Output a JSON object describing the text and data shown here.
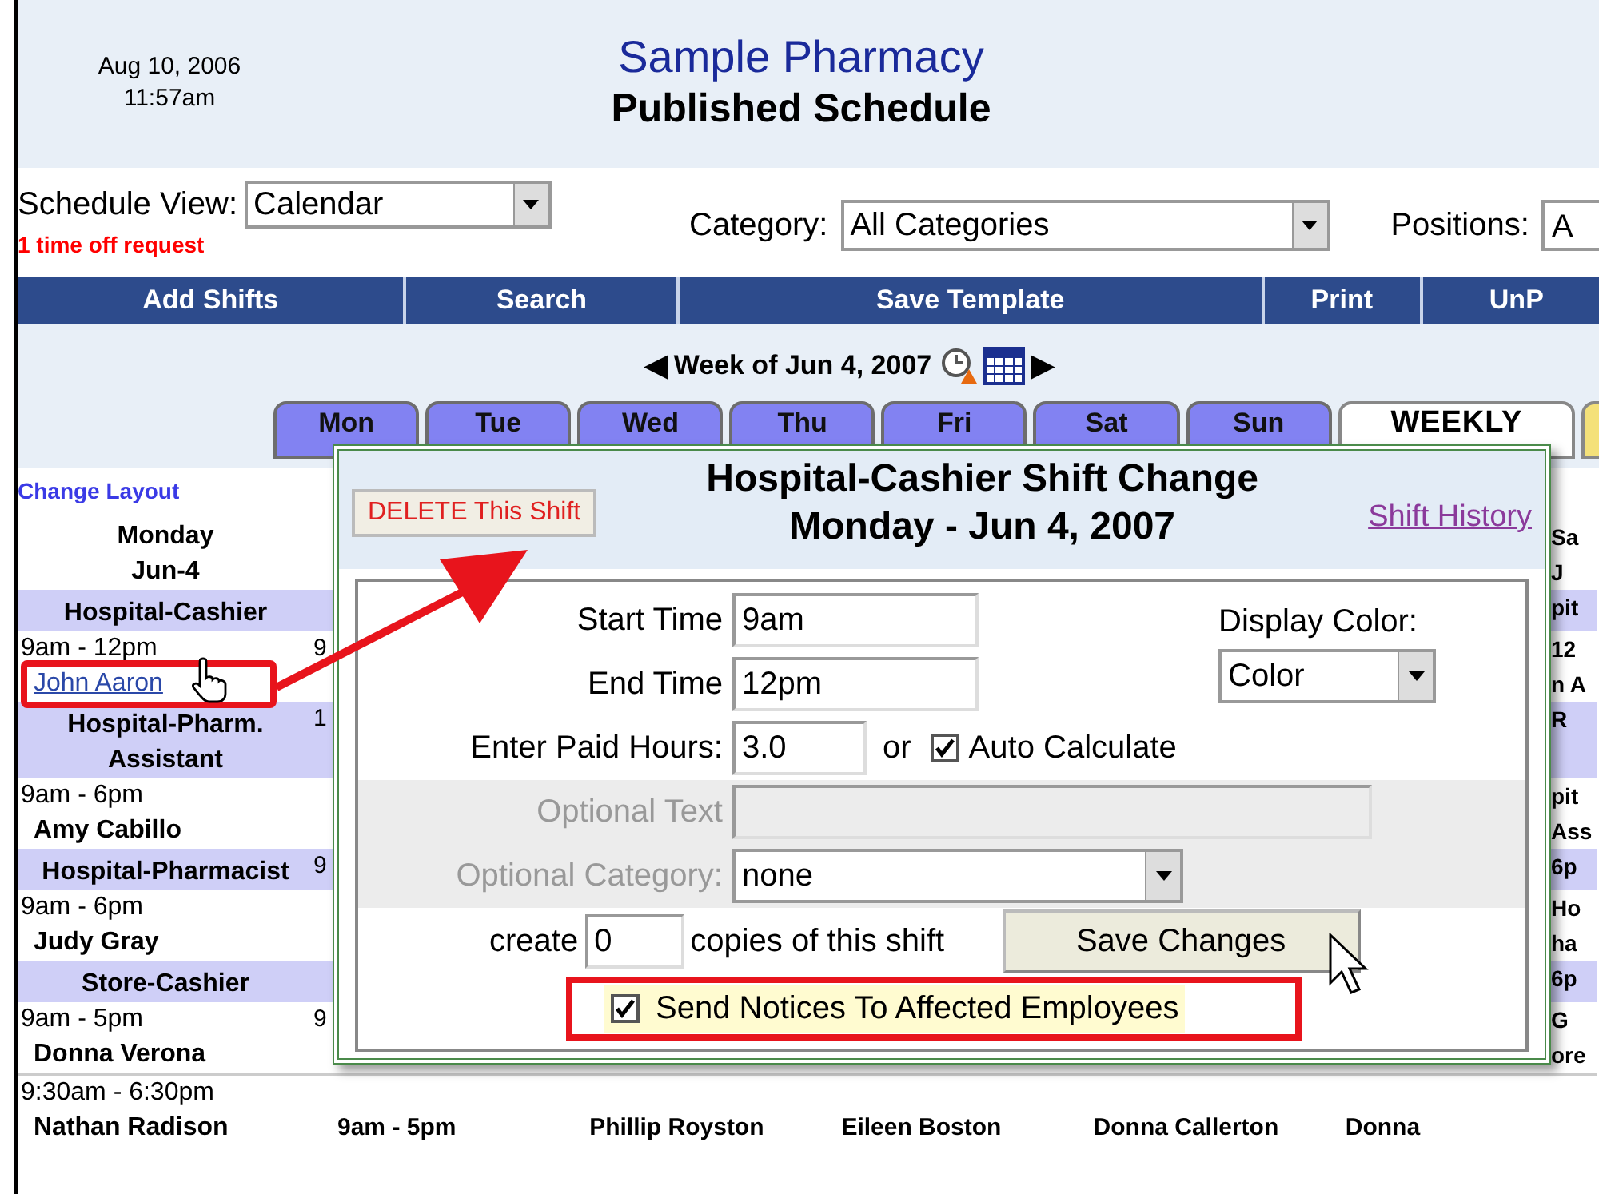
{
  "header": {
    "date": "Aug 10, 2006",
    "time": "11:57am",
    "title": "Sample Pharmacy",
    "subtitle": "Published Schedule"
  },
  "controls": {
    "schedule_view": {
      "label": "Schedule View:",
      "value": "Calendar"
    },
    "notice": "1 time off request",
    "category": {
      "label": "Category:",
      "value": "All Categories"
    },
    "positions": {
      "label": "Positions:",
      "value": "A"
    }
  },
  "nav_bar": [
    "Add Shifts",
    "Search",
    "Save Template",
    "Print",
    "UnP"
  ],
  "week_nav": {
    "prev": "◀",
    "label": "Week of Jun 4, 2007",
    "next": "▶"
  },
  "day_tabs": [
    {
      "label": "Mon",
      "selected": false
    },
    {
      "label": "Tue",
      "selected": false
    },
    {
      "label": "Wed",
      "selected": false
    },
    {
      "label": "Thu",
      "selected": false
    },
    {
      "label": "Fri",
      "selected": false
    },
    {
      "label": "Sat",
      "selected": false
    },
    {
      "label": "Sun",
      "selected": false
    },
    {
      "label": "WEEKLY",
      "selected": true
    }
  ],
  "change_layout": "Change Layout",
  "calendar_rows": [
    {
      "kind": "day",
      "text": "Monday",
      "column_last": "Sa"
    },
    {
      "kind": "day",
      "text": "Jun-4",
      "column_last": "J"
    },
    {
      "kind": "position",
      "text": "Hospital-Cashier",
      "column_last": "pit"
    },
    {
      "kind": "time",
      "text": "9am - 12pm",
      "column_2": "9",
      "column_last": "12"
    },
    {
      "kind": "link",
      "text": "John Aaron",
      "column_last": "n A"
    },
    {
      "kind": "position",
      "text": "Hospital-Pharm. Assistant",
      "column_2": "1",
      "column_last": "R"
    },
    {
      "kind": "time",
      "text": "9am - 6pm",
      "column_last": "pit"
    },
    {
      "kind": "name",
      "text": "Amy Cabillo",
      "column_last": "Ass"
    },
    {
      "kind": "position",
      "text": "Hospital-Pharmacist",
      "column_2": "9",
      "column_last": "6p"
    },
    {
      "kind": "time",
      "text": "9am - 6pm",
      "column_last": "Ho"
    },
    {
      "kind": "name",
      "text": "Judy Gray",
      "column_last": "ha"
    },
    {
      "kind": "position",
      "text": "Store-Cashier",
      "column_last": "6p"
    },
    {
      "kind": "time",
      "text": "9am - 5pm",
      "column_2": "9",
      "column_last": "G"
    },
    {
      "kind": "name",
      "text": "Donna Verona",
      "column_last": "ore"
    },
    {
      "kind": "time",
      "text": "9:30am - 6:30pm"
    },
    {
      "kind": "name",
      "text": "Nathan Radison",
      "middle": [
        "9am - 5pm",
        "Phillip Royston",
        "Eileen Boston",
        "Donna Callerton",
        "Donna"
      ]
    }
  ],
  "dialog": {
    "delete_button": "DELETE This Shift",
    "title": "Hospital-Cashier Shift Change",
    "date": "Monday - Jun 4, 2007",
    "history_link": "Shift History",
    "start_time": {
      "label": "Start Time",
      "value": "9am"
    },
    "end_time": {
      "label": "End Time",
      "value": "12pm"
    },
    "display_color": {
      "label": "Display Color:",
      "value": "Color"
    },
    "paid_hours": {
      "label": "Enter Paid Hours:",
      "value": "3.0",
      "or": "or"
    },
    "auto_calculate": {
      "label": "Auto Calculate",
      "checked": true
    },
    "optional_text": {
      "label": "Optional Text",
      "disabled": true
    },
    "optional_category": {
      "label": "Optional Category:",
      "value": "none",
      "disabled": true
    },
    "copies": {
      "before": "create",
      "value": "0",
      "after": "copies of this shift"
    },
    "save_button": "Save Changes",
    "send_notices": {
      "label": "Send Notices To Affected Employees",
      "checked": true
    }
  }
}
